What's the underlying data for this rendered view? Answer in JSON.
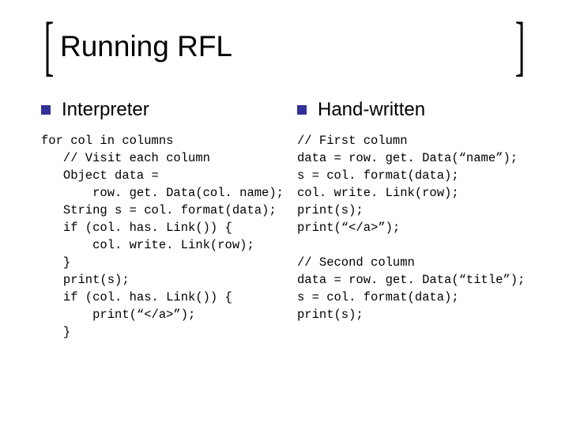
{
  "title": "Running RFL",
  "left": {
    "heading": "Interpreter",
    "code": "for col in columns\n   // Visit each column\n   Object data =\n       row. get. Data(col. name);\n   String s = col. format(data);\n   if (col. has. Link()) {\n       col. write. Link(row);\n   }\n   print(s);\n   if (col. has. Link()) {\n       print(“</a>”);\n   }"
  },
  "right": {
    "heading": "Hand-written",
    "code": "// First column\ndata = row. get. Data(“name”);\ns = col. format(data);\ncol. write. Link(row);\nprint(s);\nprint(“</a>”);\n\n// Second column\ndata = row. get. Data(“title”);\ns = col. format(data);\nprint(s);"
  }
}
